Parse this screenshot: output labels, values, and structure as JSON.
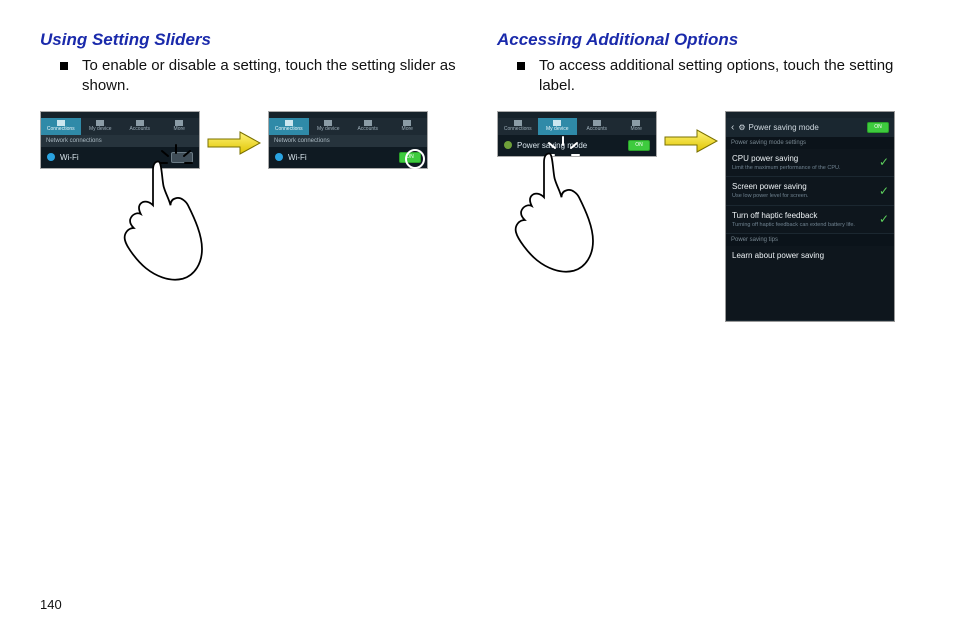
{
  "page_number": "140",
  "left": {
    "heading": "Using Setting Sliders",
    "bullet": "To enable or disable a setting, touch the setting slider as shown.",
    "tabs": [
      "Connections",
      "My device",
      "Accounts",
      "More"
    ],
    "sub": "Network connections",
    "row_label": "Wi-Fi",
    "toggle_on": "ON"
  },
  "right": {
    "heading": "Accessing Additional Options",
    "bullet": "To access additional setting options, touch the setting label.",
    "tabs": [
      "Connections",
      "My device",
      "Accounts",
      "More"
    ],
    "row_label": "Power saving mode",
    "toggle_on": "ON",
    "detail": {
      "title": "Power saving mode",
      "toggle": "ON",
      "section1": "Power saving mode settings",
      "items": [
        {
          "title": "CPU power saving",
          "desc": "Limit the maximum performance of the CPU."
        },
        {
          "title": "Screen power saving",
          "desc": "Use low power level for screen."
        },
        {
          "title": "Turn off haptic feedback",
          "desc": "Turning off haptic feedback can extend battery life."
        }
      ],
      "section2": "Power saving tips",
      "learn": "Learn about power saving"
    }
  }
}
